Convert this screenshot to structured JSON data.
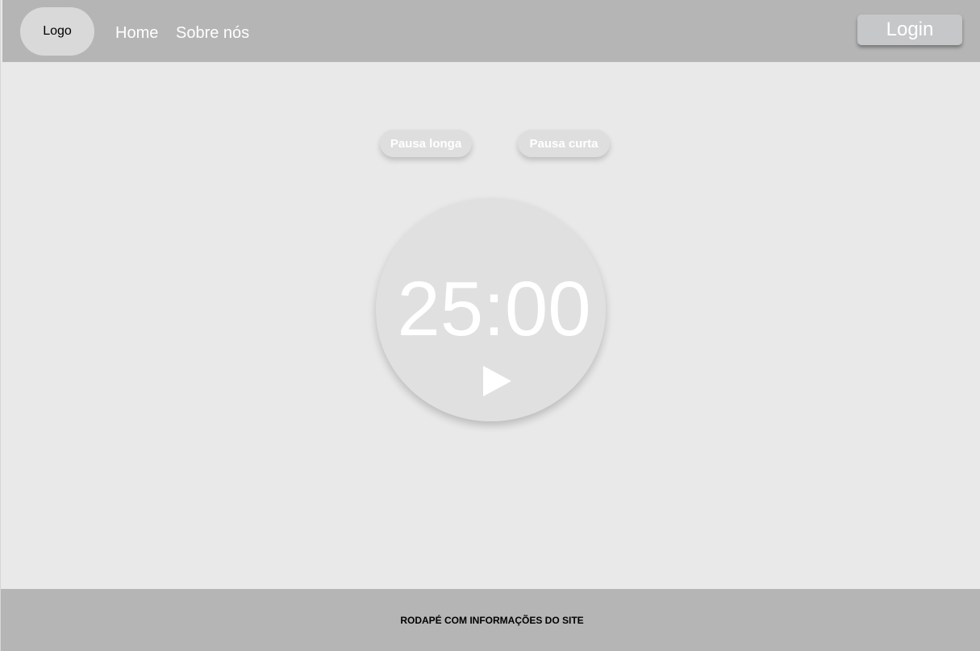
{
  "navbar": {
    "logo": "Logo",
    "links": [
      "Home",
      "Sobre nós"
    ],
    "login_label": "Login"
  },
  "timer": {
    "modes": [
      "Pausa longa",
      "Pausa curta"
    ],
    "time": "25:00",
    "play_icon": "play-icon"
  },
  "footer": {
    "text": "RODAPÉ COM INFORMAÇÕES DO SITE"
  },
  "colors": {
    "header_bg": "#b5b5b5",
    "page_bg": "#e9e9e9",
    "circle_bg": "#e0e0e0",
    "login_bg": "#c5c7c9"
  }
}
